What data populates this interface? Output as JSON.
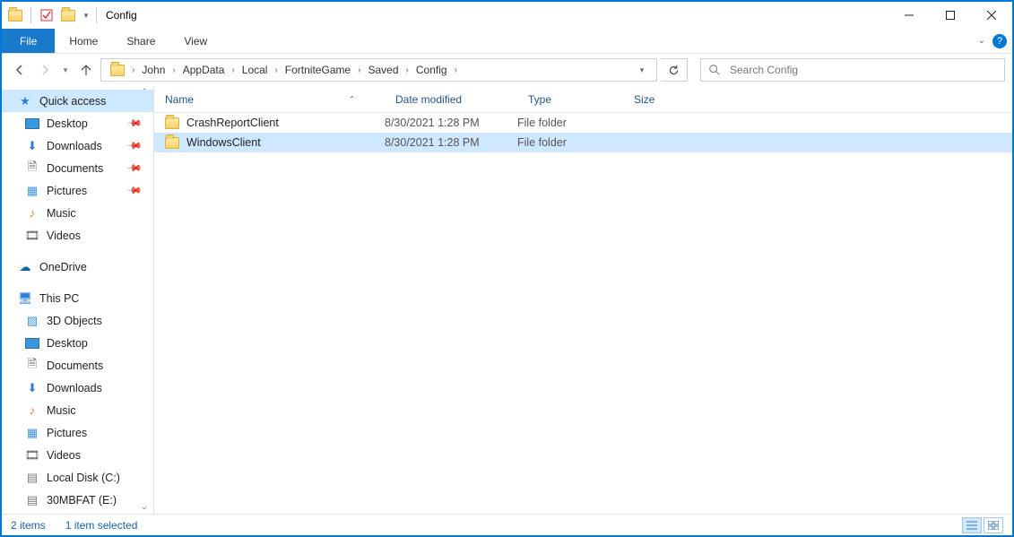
{
  "window": {
    "title": "Config"
  },
  "ribbon": {
    "file": "File",
    "tabs": [
      "Home",
      "Share",
      "View"
    ]
  },
  "breadcrumbs": [
    "John",
    "AppData",
    "Local",
    "FortniteGame",
    "Saved",
    "Config"
  ],
  "search": {
    "placeholder": "Search Config"
  },
  "navpane": {
    "quick_access": {
      "label": "Quick access",
      "items": [
        {
          "label": "Desktop",
          "pinned": true
        },
        {
          "label": "Downloads",
          "pinned": true
        },
        {
          "label": "Documents",
          "pinned": true
        },
        {
          "label": "Pictures",
          "pinned": true
        },
        {
          "label": "Music",
          "pinned": false
        },
        {
          "label": "Videos",
          "pinned": false
        }
      ]
    },
    "onedrive": {
      "label": "OneDrive"
    },
    "this_pc": {
      "label": "This PC",
      "items": [
        {
          "label": "3D Objects"
        },
        {
          "label": "Desktop"
        },
        {
          "label": "Documents"
        },
        {
          "label": "Downloads"
        },
        {
          "label": "Music"
        },
        {
          "label": "Pictures"
        },
        {
          "label": "Videos"
        },
        {
          "label": "Local Disk (C:)"
        },
        {
          "label": "30MBFAT (E:)"
        }
      ]
    }
  },
  "columns": {
    "name": "Name",
    "date": "Date modified",
    "type": "Type",
    "size": "Size"
  },
  "rows": [
    {
      "name": "CrashReportClient",
      "date": "8/30/2021 1:28 PM",
      "type": "File folder",
      "size": "",
      "selected": false
    },
    {
      "name": "WindowsClient",
      "date": "8/30/2021 1:28 PM",
      "type": "File folder",
      "size": "",
      "selected": true
    }
  ],
  "status": {
    "items": "2 items",
    "selected": "1 item selected"
  }
}
